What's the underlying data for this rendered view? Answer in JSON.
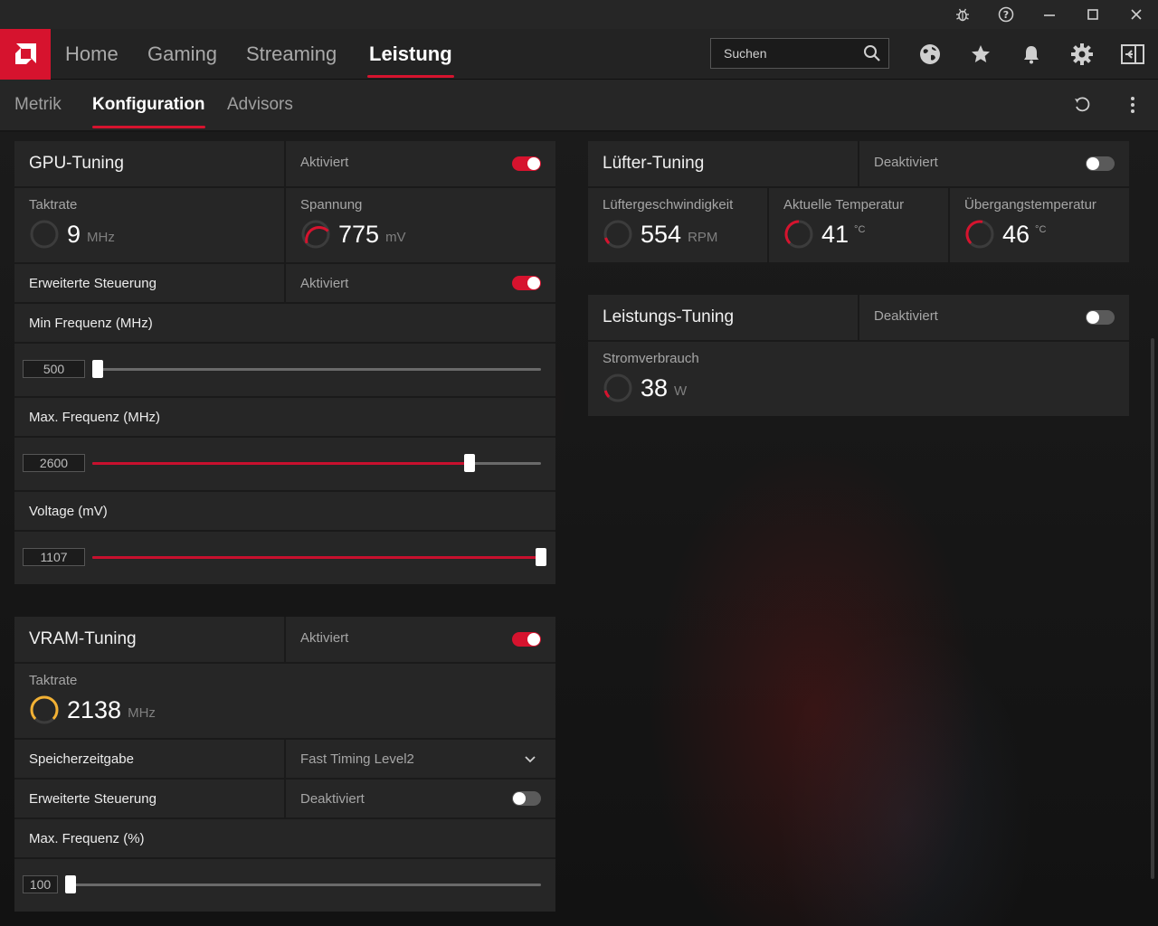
{
  "nav": {
    "items": [
      "Home",
      "Gaming",
      "Streaming",
      "Leistung"
    ],
    "active": "Leistung",
    "search_placeholder": "Suchen"
  },
  "subnav": {
    "items": [
      "Metrik",
      "Konfiguration",
      "Advisors"
    ],
    "active": "Konfiguration"
  },
  "gpu_tuning": {
    "title": "GPU-Tuning",
    "state": "Aktiviert",
    "enabled": true,
    "clock": {
      "label": "Taktrate",
      "value": "9",
      "unit": "MHz"
    },
    "voltage": {
      "label": "Spannung",
      "value": "775",
      "unit": "mV"
    },
    "advanced": {
      "label": "Erweiterte Steuerung",
      "state": "Aktiviert",
      "enabled": true
    },
    "min_freq": {
      "label": "Min Frequenz (MHz)",
      "value": "500",
      "fraction": 0.0
    },
    "max_freq": {
      "label": "Max. Frequenz (MHz)",
      "value": "2600",
      "fraction": 0.84
    },
    "voltage_slider": {
      "label": "Voltage (mV)",
      "value": "1107",
      "fraction": 1.0
    }
  },
  "vram_tuning": {
    "title": "VRAM-Tuning",
    "state": "Aktiviert",
    "enabled": true,
    "clock": {
      "label": "Taktrate",
      "value": "2138",
      "unit": "MHz"
    },
    "timing": {
      "label": "Speicherzeitgabe",
      "value": "Fast Timing Level2"
    },
    "advanced": {
      "label": "Erweiterte Steuerung",
      "state": "Deaktiviert",
      "enabled": false
    },
    "max_freq": {
      "label": "Max. Frequenz (%)",
      "value": "100",
      "fraction": 0.0
    }
  },
  "fan_tuning": {
    "title": "Lüfter-Tuning",
    "state": "Deaktiviert",
    "enabled": false,
    "speed": {
      "label": "Lüftergeschwindigkeit",
      "value": "554",
      "unit": "RPM"
    },
    "temp": {
      "label": "Aktuelle Temperatur",
      "value": "41",
      "unit": "°C"
    },
    "junction": {
      "label": "Übergangstemperatur",
      "value": "46",
      "unit": "°C"
    }
  },
  "power_tuning": {
    "title": "Leistungs-Tuning",
    "state": "Deaktiviert",
    "enabled": false,
    "power": {
      "label": "Stromverbrauch",
      "value": "38",
      "unit": "W"
    }
  },
  "colors": {
    "accent": "#d6132e",
    "gauge_warm": "#f2b134"
  },
  "icons": [
    "bug-icon",
    "help-icon",
    "minimize-icon",
    "maximize-icon",
    "close-icon",
    "amd-logo-icon",
    "search-icon",
    "globe-icon",
    "star-icon",
    "bell-icon",
    "gear-icon",
    "sidebar-toggle-icon",
    "reset-icon",
    "more-icon",
    "chevron-down-icon"
  ]
}
